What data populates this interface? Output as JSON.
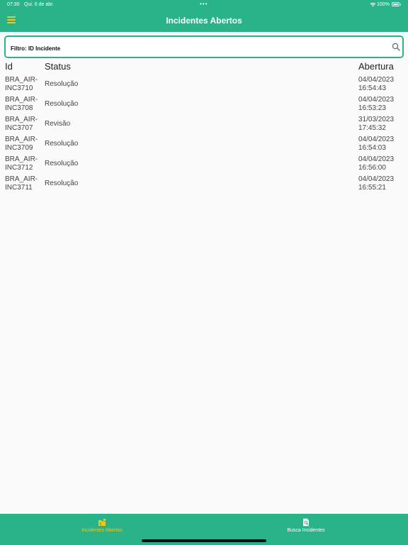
{
  "status_bar": {
    "time": "07:30",
    "date": "Qui. 6 de abr.",
    "battery": "100%"
  },
  "header": {
    "title": "Incidentes Abertos",
    "accent_color": "#2ab389",
    "icon_color": "#f4c51c"
  },
  "filter": {
    "placeholder": "Filtro: ID Incidente",
    "value": ""
  },
  "table": {
    "columns": [
      "Id",
      "Status",
      "Abertura"
    ],
    "rows": [
      {
        "id": "BRA_AIR-INC3710",
        "status": "Resolução",
        "date": "04/04/2023",
        "time": "16:54:43"
      },
      {
        "id": "BRA_AIR-INC3708",
        "status": "Resolução",
        "date": "04/04/2023",
        "time": "16:53:23"
      },
      {
        "id": "BRA_AIR-INC3707",
        "status": "Revisão",
        "date": "31/03/2023",
        "time": "17:45:32"
      },
      {
        "id": "BRA_AIR-INC3709",
        "status": "Resolução",
        "date": "04/04/2023",
        "time": "16:54:03"
      },
      {
        "id": "BRA_AIR-INC3712",
        "status": "Resolução",
        "date": "04/04/2023",
        "time": "16:56:00"
      },
      {
        "id": "BRA_AIR-INC3711",
        "status": "Resolução",
        "date": "04/04/2023",
        "time": "16:55:21"
      }
    ]
  },
  "tabbar": {
    "tabs": [
      {
        "label": "Incidentes Abertos",
        "icon": "open-incidents-icon",
        "active": true
      },
      {
        "label": "Busca Incidentes",
        "icon": "search-document-icon",
        "active": false
      }
    ]
  }
}
